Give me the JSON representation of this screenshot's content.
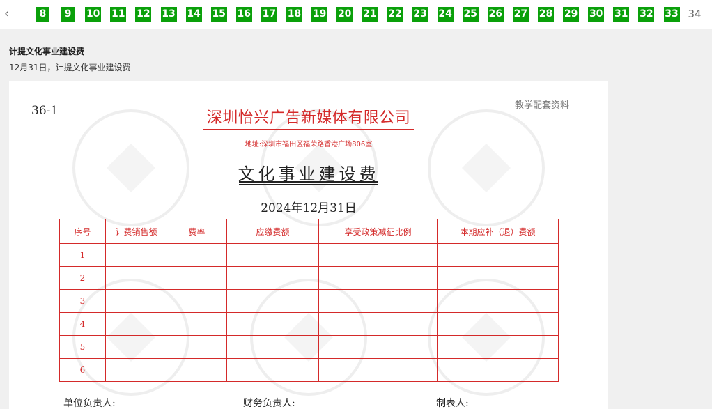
{
  "pagination": {
    "prev_icon": "chevron-left-icon",
    "pages": [
      "8",
      "9",
      "10",
      "11",
      "12",
      "13",
      "14",
      "15",
      "16",
      "17",
      "18",
      "19",
      "20",
      "21",
      "22",
      "23",
      "24",
      "25",
      "26",
      "27",
      "28",
      "29",
      "30",
      "31",
      "32",
      "33"
    ],
    "current": "34",
    "answered_color": "#0aa00a"
  },
  "question": {
    "title": "计提文化事业建设费",
    "subtitle": "12月31日，计提文化事业建设费"
  },
  "document": {
    "code": "36-1",
    "note": "教学配套资料",
    "company": "深圳怡兴广告新媒体有限公司",
    "address": "地址:深圳市福田区福荣路香港广场806室",
    "title": "文化事业建设费",
    "date": "2024年12月31日",
    "accent_color": "#d42a2a",
    "table": {
      "headers": [
        "序号",
        "计费销售额",
        "费率",
        "应缴费额",
        "享受政策减征比例",
        "本期应补（退）费额"
      ],
      "rows": [
        "1",
        "2",
        "3",
        "4",
        "5",
        "6"
      ]
    },
    "signatures": {
      "unit_head": "单位负责人:",
      "finance_head": "财务负责人:",
      "preparer": "制表人:"
    }
  }
}
